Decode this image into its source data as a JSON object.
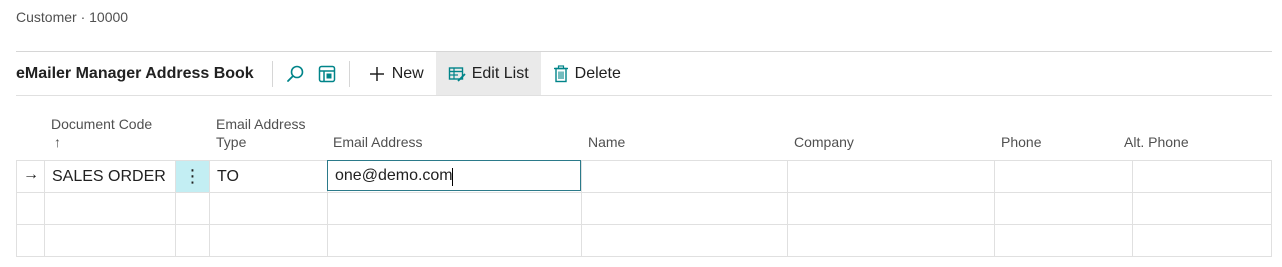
{
  "breadcrumb": "Customer · 10000",
  "toolbar": {
    "title": "eMailer Manager Address Book",
    "search_icon": "search-icon",
    "filter_pane_icon": "filter-pane-icon",
    "new_label": "New",
    "edit_list_label": "Edit List",
    "delete_label": "Delete"
  },
  "columns": {
    "document_code": "Document Code",
    "document_code_sort": "↑",
    "email_type_line1": "Email Address",
    "email_type_line2": "Type",
    "email_address": "Email Address",
    "name": "Name",
    "company": "Company",
    "phone": "Phone",
    "alt_phone": "Alt. Phone"
  },
  "rows": [
    {
      "indicator": "→",
      "document_code": "SALES ORDER",
      "menu": "⋮",
      "email_type": "TO",
      "email_address": "one@demo.com",
      "name": "",
      "company": "",
      "phone": "",
      "alt_phone": ""
    }
  ],
  "colors": {
    "accent": "#008489",
    "selected_cell": "#c3eef3"
  }
}
